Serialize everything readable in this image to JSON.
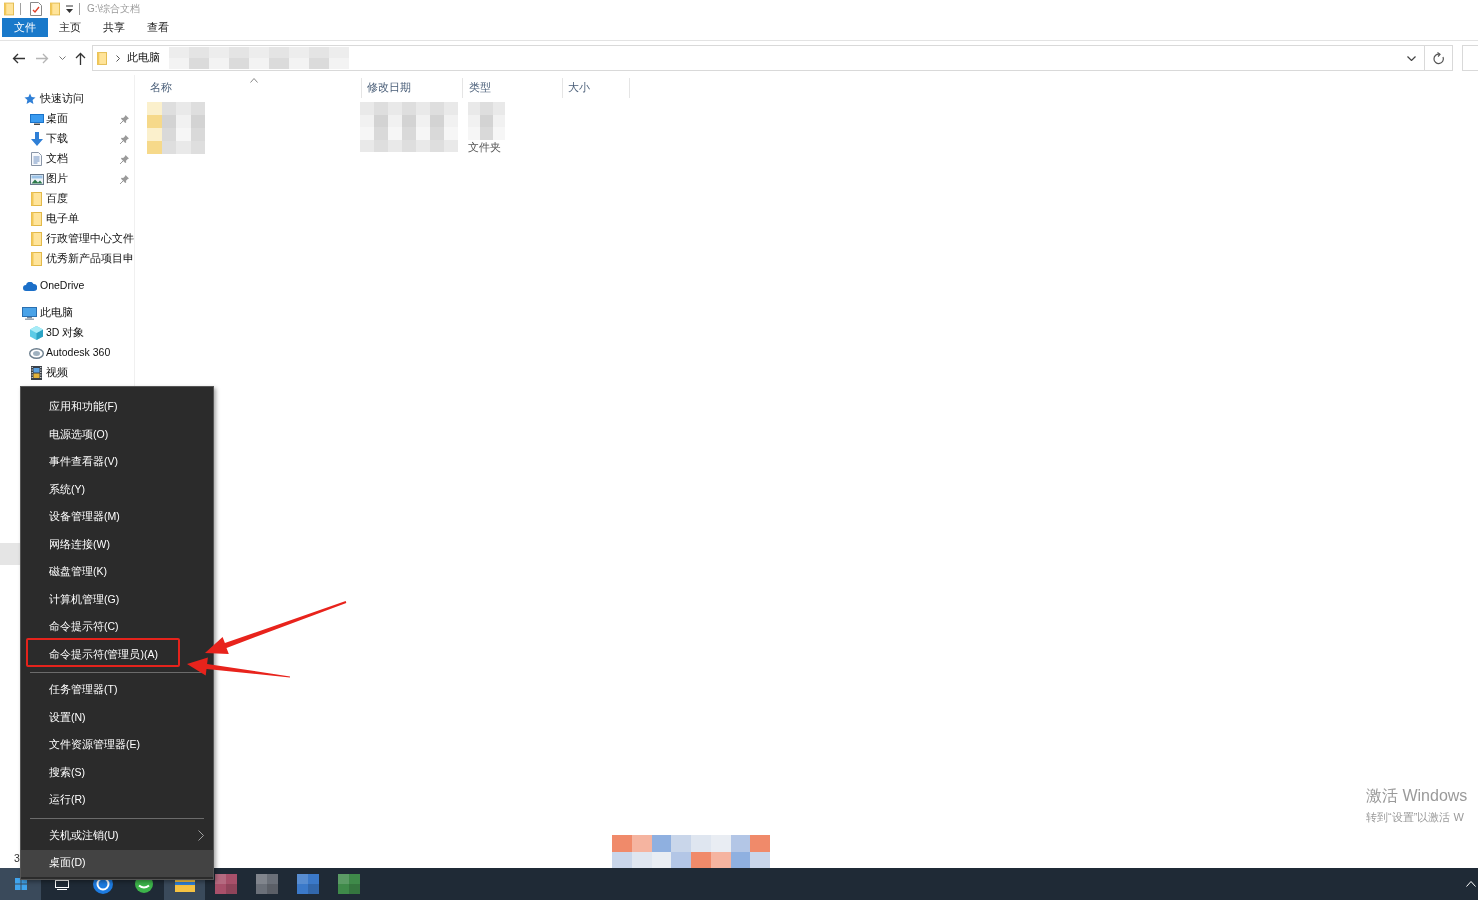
{
  "window": {
    "title": "G:\\综合文档"
  },
  "ribbon_tabs": [
    {
      "label": "文件",
      "kind": "file"
    },
    {
      "label": "主页",
      "kind": "tab"
    },
    {
      "label": "共享",
      "kind": "tab"
    },
    {
      "label": "查看",
      "kind": "tab"
    }
  ],
  "address_bar": {
    "segments": [
      "此电脑"
    ]
  },
  "sidebar": {
    "items": [
      {
        "label": "快速访问",
        "kind": "star",
        "pinned": false,
        "children": [
          {
            "label": "桌面",
            "kind": "desktop",
            "pinned": true
          },
          {
            "label": "下载",
            "kind": "downloads",
            "pinned": true
          },
          {
            "label": "文档",
            "kind": "documents",
            "pinned": true
          },
          {
            "label": "图片",
            "kind": "pictures",
            "pinned": true
          },
          {
            "label": "百度",
            "kind": "folder",
            "pinned": false
          },
          {
            "label": "电子单",
            "kind": "folder",
            "pinned": false
          },
          {
            "label": "行政管理中心文件",
            "kind": "folder",
            "pinned": false
          },
          {
            "label": "优秀新产品项目申",
            "kind": "folder",
            "pinned": false
          }
        ]
      },
      {
        "label": "OneDrive",
        "kind": "cloud",
        "pinned": false
      },
      {
        "label": "此电脑",
        "kind": "computer",
        "pinned": false,
        "children": [
          {
            "label": "3D 对象",
            "kind": "objects",
            "pinned": false
          },
          {
            "label": "Autodesk 360",
            "kind": "drive",
            "pinned": false
          },
          {
            "label": "视频",
            "kind": "videos",
            "pinned": false
          }
        ]
      }
    ]
  },
  "file_list": {
    "columns": [
      {
        "label": "名称",
        "sorted": true
      },
      {
        "label": "修改日期",
        "sorted": false
      },
      {
        "label": "类型",
        "sorted": false
      },
      {
        "label": "大小",
        "sorted": false
      }
    ],
    "rows": [
      {
        "item_type": "文件夹"
      }
    ]
  },
  "status_bar": {
    "text": "3"
  },
  "context_menu": {
    "items": [
      {
        "kind": "item",
        "label": "应用和功能(F)",
        "submenu": false,
        "selected": false,
        "boxed": false
      },
      {
        "kind": "item",
        "label": "电源选项(O)",
        "submenu": false,
        "selected": false,
        "boxed": false
      },
      {
        "kind": "item",
        "label": "事件查看器(V)",
        "submenu": false,
        "selected": false,
        "boxed": false
      },
      {
        "kind": "item",
        "label": "系统(Y)",
        "submenu": false,
        "selected": false,
        "boxed": false
      },
      {
        "kind": "item",
        "label": "设备管理器(M)",
        "submenu": false,
        "selected": false,
        "boxed": false
      },
      {
        "kind": "item",
        "label": "网络连接(W)",
        "submenu": false,
        "selected": false,
        "boxed": false
      },
      {
        "kind": "item",
        "label": "磁盘管理(K)",
        "submenu": false,
        "selected": false,
        "boxed": false
      },
      {
        "kind": "item",
        "label": "计算机管理(G)",
        "submenu": false,
        "selected": false,
        "boxed": false
      },
      {
        "kind": "item",
        "label": "命令提示符(C)",
        "submenu": false,
        "selected": false,
        "boxed": false
      },
      {
        "kind": "item",
        "label": "命令提示符(管理员)(A)",
        "submenu": false,
        "selected": false,
        "boxed": true
      },
      {
        "kind": "separator"
      },
      {
        "kind": "item",
        "label": "任务管理器(T)",
        "submenu": false,
        "selected": false,
        "boxed": false
      },
      {
        "kind": "item",
        "label": "设置(N)",
        "submenu": false,
        "selected": false,
        "boxed": false
      },
      {
        "kind": "item",
        "label": "文件资源管理器(E)",
        "submenu": false,
        "selected": false,
        "boxed": false
      },
      {
        "kind": "item",
        "label": "搜索(S)",
        "submenu": false,
        "selected": false,
        "boxed": false
      },
      {
        "kind": "item",
        "label": "运行(R)",
        "submenu": false,
        "selected": false,
        "boxed": false
      },
      {
        "kind": "separator"
      },
      {
        "kind": "item",
        "label": "关机或注销(U)",
        "submenu": true,
        "selected": false,
        "boxed": false
      },
      {
        "kind": "item",
        "label": "桌面(D)",
        "submenu": false,
        "selected": true,
        "boxed": false
      }
    ]
  },
  "taskbar": {
    "buttons": [
      {
        "kind": "start",
        "active": true
      },
      {
        "kind": "taskview",
        "active": false
      },
      {
        "kind": "ring",
        "active": false
      },
      {
        "kind": "bubble",
        "active": false
      },
      {
        "kind": "explorer",
        "active": true
      },
      {
        "kind": "blurred",
        "color": "#a8506a",
        "active": false
      },
      {
        "kind": "blurred",
        "color": "#6b7079",
        "active": false
      },
      {
        "kind": "blurred",
        "color": "#3b79c9",
        "active": false
      },
      {
        "kind": "blurred",
        "color": "#3f8a4a",
        "active": false
      }
    ]
  },
  "activation_notice": {
    "title": "激活 Windows",
    "subtitle": "转到“设置”以激活 W"
  }
}
